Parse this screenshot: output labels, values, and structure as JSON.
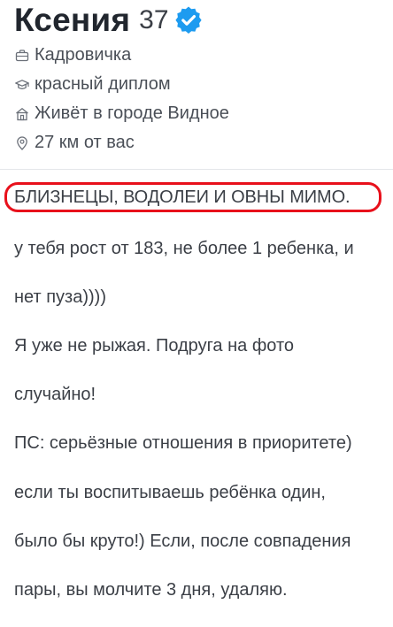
{
  "profile": {
    "name": "Ксения",
    "age": "37",
    "verified_icon": "verified-badge-icon",
    "accent_color": "#1d9bf0"
  },
  "info": [
    {
      "icon": "briefcase-icon",
      "text": "Кадровичка"
    },
    {
      "icon": "graduation-cap-icon",
      "text": "красный диплом"
    },
    {
      "icon": "home-icon",
      "text": "Живёт в городе Видное"
    },
    {
      "icon": "location-pin-icon",
      "text": "27 км от вас"
    }
  ],
  "bio": {
    "highlight": "БЛИЗНЕЦЫ, ВОДОЛЕИ И ОВНЫ МИМО.",
    "highlight_color": "#e8101b",
    "lines": [
      "у тебя рост от 183, не более 1 ребенка, и",
      "нет пуза))))",
      "Я уже не рыжая. Подруга на фото",
      "случайно!",
      "ПС: серьёзные отношения в приоритете)",
      "если ты воспитываешь ребёнка один,",
      "было бы круто!) Если, после совпадения",
      "пары, вы молчите 3 дня, удаляю."
    ]
  }
}
